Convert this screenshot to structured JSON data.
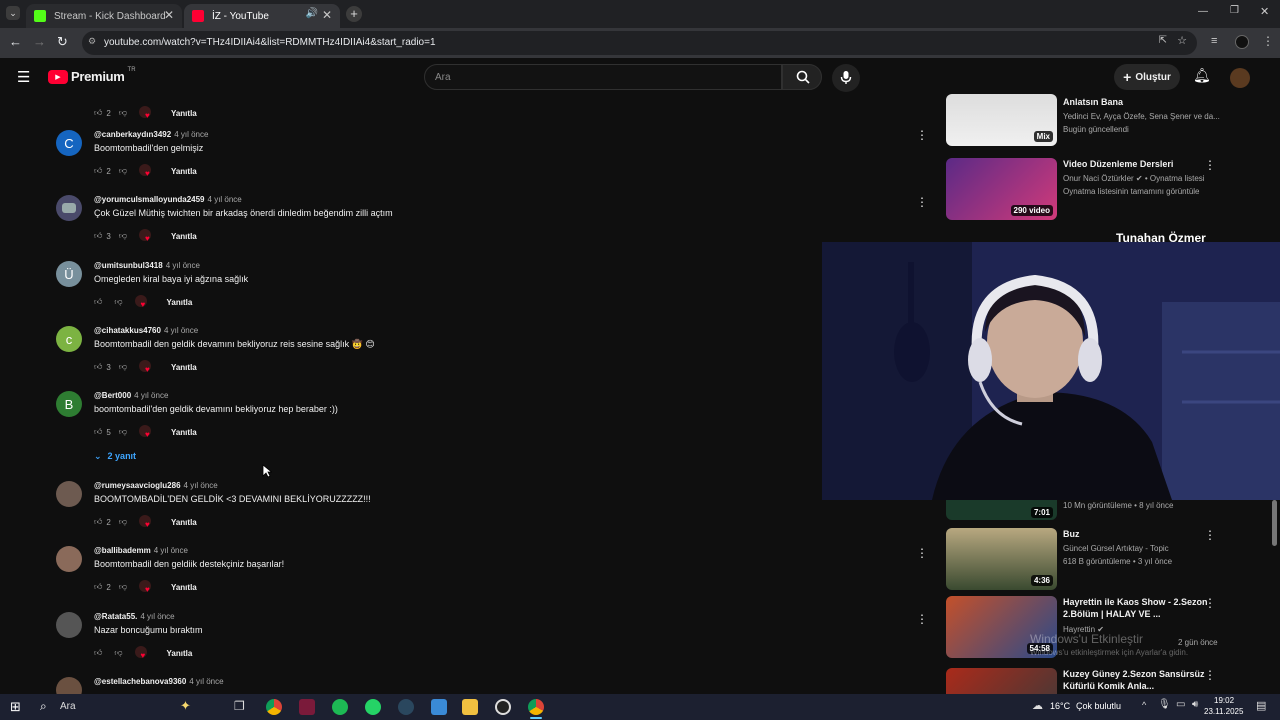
{
  "browser": {
    "tabs": [
      {
        "title": "Stream - Kick Dashboard"
      },
      {
        "title": "İZ - YouTube"
      }
    ],
    "url": "youtube.com/watch?v=THz4IDIIAi4&list=RDMMTHz4IDIIAi4&start_radio=1"
  },
  "youtube": {
    "logo_text": "Premium",
    "region": "TR",
    "search_placeholder": "Ara",
    "create_label": "Oluştur"
  },
  "comments": [
    {
      "user": "",
      "ago": "",
      "text": "",
      "likes": "2",
      "reply": "Yanıtla"
    },
    {
      "user": "@canberkaydın3492",
      "ago": "4 yıl önce",
      "text": "Boomtombadil'den gelmişiz",
      "likes": "2",
      "reply": "Yanıtla",
      "initial": "C",
      "color": "#1565c0"
    },
    {
      "user": "@yorumculsmalloyunda2459",
      "ago": "4 yıl önce",
      "text": "Çok Güzel Müthiş twichten bir arkadaş önerdi dinledim beğendim zilli açtım",
      "likes": "3",
      "reply": "Yanıtla",
      "initial": "",
      "color": "#4a4a6a"
    },
    {
      "user": "@umitsunbul3418",
      "ago": "4 yıl önce",
      "text": "Omegleden kiral baya iyi ağzına sağlık",
      "likes": "",
      "reply": "Yanıtla",
      "initial": "Ü",
      "color": "#78909c"
    },
    {
      "user": "@cihatakkus4760",
      "ago": "4 yıl önce",
      "text": "Boomtombadil den geldik devamını bekliyoruz reis sesine sağlık 🤠 😊",
      "likes": "3",
      "reply": "Yanıtla",
      "initial": "c",
      "color": "#7cb342"
    },
    {
      "user": "@Bert000",
      "ago": "4 yıl önce",
      "text": "boomtombadil'den geldik devamını bekliyoruz hep beraber :))",
      "likes": "5",
      "reply": "Yanıtla",
      "initial": "B",
      "color": "#2e7d32"
    },
    {
      "user": "@rumeysaavcioglu286",
      "ago": "4 yıl önce",
      "text": "BOOMTOMBADİL'DEN GELDİK <3 DEVAMINI BEKLİYORUZZZZZ!!!",
      "likes": "2",
      "reply": "Yanıtla",
      "initial": "",
      "color": "#6d5a50"
    },
    {
      "user": "@ballibademm",
      "ago": "4 yıl önce",
      "text": "Boomtombadil den geldiik destekçiniz başarılar!",
      "likes": "2",
      "reply": "Yanıtla",
      "initial": "",
      "color": "#8a6a5a"
    },
    {
      "user": "@Ratata55.",
      "ago": "4 yıl önce",
      "text": "Nazar boncuğumu bıraktım",
      "likes": "",
      "reply": "Yanıtla",
      "initial": "",
      "color": "#555"
    },
    {
      "user": "@estellachebanova9360",
      "ago": "4 yıl önce",
      "text": "",
      "likes": "",
      "reply": "",
      "initial": "",
      "color": "#6a5040"
    }
  ],
  "replies_toggle": "2 yanıt",
  "sidebar": [
    {
      "title": "Anlatsın Bana",
      "channel": "Yedinci Ev, Ayça Özefe, Sena Şener ve da...",
      "meta": "Bugün güncellendi",
      "badge": "Mix"
    },
    {
      "title": "Video Düzenleme Dersleri",
      "channel": "Onur Naci Öztürkler ✔ • Oynatma listesi",
      "meta": "Oynatma listesinin tamamını görüntüle",
      "badge": "290 video"
    },
    {
      "title": "",
      "channel": "",
      "meta": "10 Mn görüntüleme • 8 yıl önce",
      "badge": "7:01"
    },
    {
      "title": "Buz",
      "channel": "Güncel Gürsel Artıktay - Topic",
      "meta": "618 B görüntüleme • 3 yıl önce",
      "badge": "4:36"
    },
    {
      "title": "Hayrettin ile Kaos Show - 2.Sezon 2.Bölüm | HALAY VE ...",
      "channel": "Hayrettin ✔",
      "meta": "2 gün önce",
      "badge": "54:58"
    },
    {
      "title": "Kuzey Güney 2.Sezon Sansürsüz Küfürlü Komik Anla...",
      "channel": "",
      "meta": "",
      "badge": ""
    }
  ],
  "webcam": {
    "name": "Tunahan Özmer"
  },
  "watermark": {
    "line1": "Windows'u Etkinleştir",
    "line2": "Windows'u etkinleştirmek için Ayarlar'a gidin."
  },
  "taskbar": {
    "search": "Ara",
    "weather": "16°C",
    "weather_text": "Çok bulutlu",
    "time": "19:02",
    "date": "23.11.2025"
  }
}
